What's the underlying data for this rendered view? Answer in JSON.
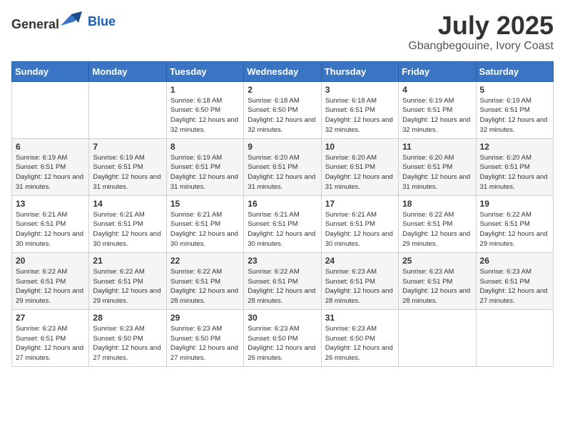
{
  "header": {
    "logo_general": "General",
    "logo_blue": "Blue",
    "month_year": "July 2025",
    "location": "Gbangbegouine, Ivory Coast"
  },
  "weekdays": [
    "Sunday",
    "Monday",
    "Tuesday",
    "Wednesday",
    "Thursday",
    "Friday",
    "Saturday"
  ],
  "weeks": [
    [
      {
        "day": "",
        "info": ""
      },
      {
        "day": "",
        "info": ""
      },
      {
        "day": "1",
        "info": "Sunrise: 6:18 AM\nSunset: 6:50 PM\nDaylight: 12 hours and 32 minutes."
      },
      {
        "day": "2",
        "info": "Sunrise: 6:18 AM\nSunset: 6:50 PM\nDaylight: 12 hours and 32 minutes."
      },
      {
        "day": "3",
        "info": "Sunrise: 6:18 AM\nSunset: 6:51 PM\nDaylight: 12 hours and 32 minutes."
      },
      {
        "day": "4",
        "info": "Sunrise: 6:19 AM\nSunset: 6:51 PM\nDaylight: 12 hours and 32 minutes."
      },
      {
        "day": "5",
        "info": "Sunrise: 6:19 AM\nSunset: 6:51 PM\nDaylight: 12 hours and 32 minutes."
      }
    ],
    [
      {
        "day": "6",
        "info": "Sunrise: 6:19 AM\nSunset: 6:51 PM\nDaylight: 12 hours and 31 minutes."
      },
      {
        "day": "7",
        "info": "Sunrise: 6:19 AM\nSunset: 6:51 PM\nDaylight: 12 hours and 31 minutes."
      },
      {
        "day": "8",
        "info": "Sunrise: 6:19 AM\nSunset: 6:51 PM\nDaylight: 12 hours and 31 minutes."
      },
      {
        "day": "9",
        "info": "Sunrise: 6:20 AM\nSunset: 6:51 PM\nDaylight: 12 hours and 31 minutes."
      },
      {
        "day": "10",
        "info": "Sunrise: 6:20 AM\nSunset: 6:51 PM\nDaylight: 12 hours and 31 minutes."
      },
      {
        "day": "11",
        "info": "Sunrise: 6:20 AM\nSunset: 6:51 PM\nDaylight: 12 hours and 31 minutes."
      },
      {
        "day": "12",
        "info": "Sunrise: 6:20 AM\nSunset: 6:51 PM\nDaylight: 12 hours and 31 minutes."
      }
    ],
    [
      {
        "day": "13",
        "info": "Sunrise: 6:21 AM\nSunset: 6:51 PM\nDaylight: 12 hours and 30 minutes."
      },
      {
        "day": "14",
        "info": "Sunrise: 6:21 AM\nSunset: 6:51 PM\nDaylight: 12 hours and 30 minutes."
      },
      {
        "day": "15",
        "info": "Sunrise: 6:21 AM\nSunset: 6:51 PM\nDaylight: 12 hours and 30 minutes."
      },
      {
        "day": "16",
        "info": "Sunrise: 6:21 AM\nSunset: 6:51 PM\nDaylight: 12 hours and 30 minutes."
      },
      {
        "day": "17",
        "info": "Sunrise: 6:21 AM\nSunset: 6:51 PM\nDaylight: 12 hours and 30 minutes."
      },
      {
        "day": "18",
        "info": "Sunrise: 6:22 AM\nSunset: 6:51 PM\nDaylight: 12 hours and 29 minutes."
      },
      {
        "day": "19",
        "info": "Sunrise: 6:22 AM\nSunset: 6:51 PM\nDaylight: 12 hours and 29 minutes."
      }
    ],
    [
      {
        "day": "20",
        "info": "Sunrise: 6:22 AM\nSunset: 6:51 PM\nDaylight: 12 hours and 29 minutes."
      },
      {
        "day": "21",
        "info": "Sunrise: 6:22 AM\nSunset: 6:51 PM\nDaylight: 12 hours and 29 minutes."
      },
      {
        "day": "22",
        "info": "Sunrise: 6:22 AM\nSunset: 6:51 PM\nDaylight: 12 hours and 28 minutes."
      },
      {
        "day": "23",
        "info": "Sunrise: 6:22 AM\nSunset: 6:51 PM\nDaylight: 12 hours and 28 minutes."
      },
      {
        "day": "24",
        "info": "Sunrise: 6:23 AM\nSunset: 6:51 PM\nDaylight: 12 hours and 28 minutes."
      },
      {
        "day": "25",
        "info": "Sunrise: 6:23 AM\nSunset: 6:51 PM\nDaylight: 12 hours and 28 minutes."
      },
      {
        "day": "26",
        "info": "Sunrise: 6:23 AM\nSunset: 6:51 PM\nDaylight: 12 hours and 27 minutes."
      }
    ],
    [
      {
        "day": "27",
        "info": "Sunrise: 6:23 AM\nSunset: 6:51 PM\nDaylight: 12 hours and 27 minutes."
      },
      {
        "day": "28",
        "info": "Sunrise: 6:23 AM\nSunset: 6:50 PM\nDaylight: 12 hours and 27 minutes."
      },
      {
        "day": "29",
        "info": "Sunrise: 6:23 AM\nSunset: 6:50 PM\nDaylight: 12 hours and 27 minutes."
      },
      {
        "day": "30",
        "info": "Sunrise: 6:23 AM\nSunset: 6:50 PM\nDaylight: 12 hours and 26 minutes."
      },
      {
        "day": "31",
        "info": "Sunrise: 6:23 AM\nSunset: 6:50 PM\nDaylight: 12 hours and 26 minutes."
      },
      {
        "day": "",
        "info": ""
      },
      {
        "day": "",
        "info": ""
      }
    ]
  ]
}
